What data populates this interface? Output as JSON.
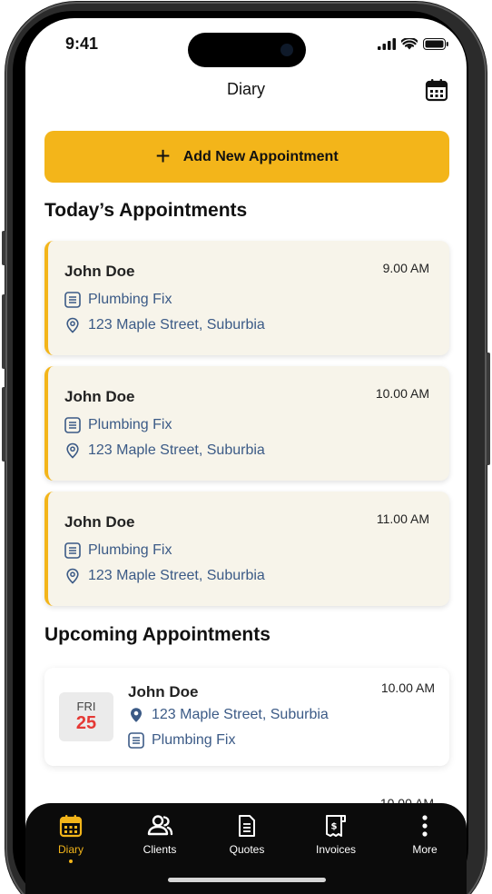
{
  "status": {
    "time": "9:41"
  },
  "header": {
    "title": "Diary"
  },
  "actions": {
    "add_label": "Add New Appointment"
  },
  "today": {
    "title": "Today’s Appointments",
    "items": [
      {
        "name": "John Doe",
        "time": "9.00 AM",
        "service": "Plumbing Fix",
        "address": "123 Maple Street, Suburbia"
      },
      {
        "name": "John Doe",
        "time": "10.00 AM",
        "service": "Plumbing Fix",
        "address": "123 Maple Street, Suburbia"
      },
      {
        "name": "John Doe",
        "time": "11.00 AM",
        "service": "Plumbing Fix",
        "address": "123 Maple Street, Suburbia"
      }
    ]
  },
  "upcoming": {
    "title": "Upcoming Appointments",
    "items": [
      {
        "dow": "FRI",
        "day": "25",
        "name": "John Doe",
        "time": "10.00 AM",
        "address": "123 Maple Street, Suburbia",
        "service": "Plumbing Fix"
      }
    ],
    "peek_time": "10.00 AM"
  },
  "nav": {
    "items": [
      {
        "label": "Diary",
        "icon": "calendar-icon"
      },
      {
        "label": "Clients",
        "icon": "users-icon"
      },
      {
        "label": "Quotes",
        "icon": "document-icon"
      },
      {
        "label": "Invoices",
        "icon": "receipt-icon"
      },
      {
        "label": "More",
        "icon": "more-vertical-icon"
      }
    ]
  },
  "colors": {
    "accent": "#f3b51a",
    "link": "#3b5a86",
    "date_red": "#e53935",
    "card_bg": "#f7f4ea",
    "nav_bg": "#0b0b0b"
  }
}
